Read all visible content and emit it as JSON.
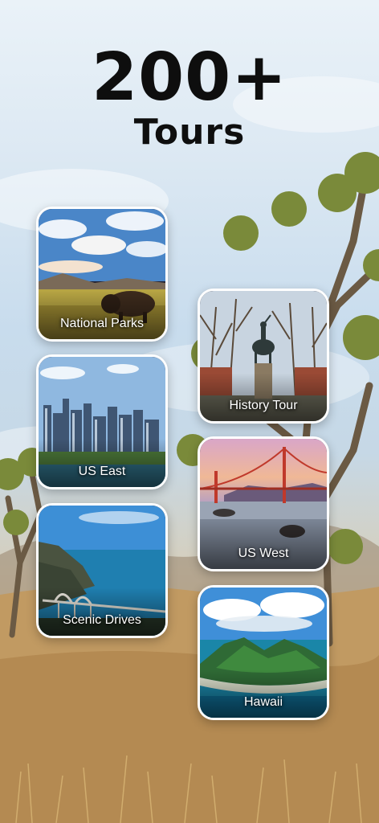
{
  "header": {
    "count": "200+",
    "label": "Tours"
  },
  "tours": {
    "national_parks": "National Parks",
    "history_tour": "History Tour",
    "us_east": "US East",
    "us_west": "US West",
    "scenic_drives": "Scenic Drives",
    "hawaii": "Hawaii"
  },
  "colors": {
    "title_text": "#0e0e0e",
    "card_border": "#ffffff",
    "label_text": "#ffffff"
  }
}
